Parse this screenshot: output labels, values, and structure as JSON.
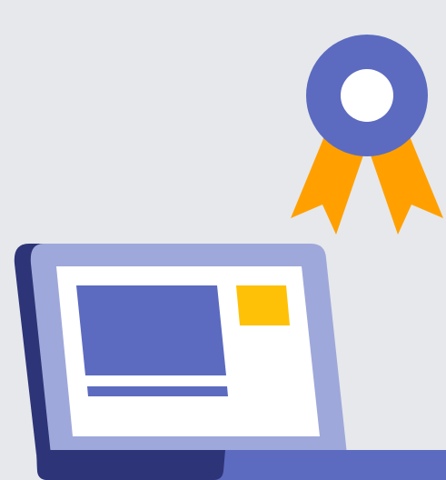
{
  "illustration": {
    "subjects": [
      "laptop-with-certificate-icon",
      "award-ribbon-icon"
    ],
    "colors": {
      "background": "#e6e8eb",
      "laptop_frame": "#9fa8da",
      "laptop_frame_shadow": "#2e3478",
      "laptop_base": "#5c6bc0",
      "screen": "#ffffff",
      "screen_block": "#5c6bc0",
      "screen_accent": "#ffc107",
      "badge_circle": "#5c6bc0",
      "badge_center": "#ffffff",
      "ribbon": "#ffa000"
    }
  }
}
